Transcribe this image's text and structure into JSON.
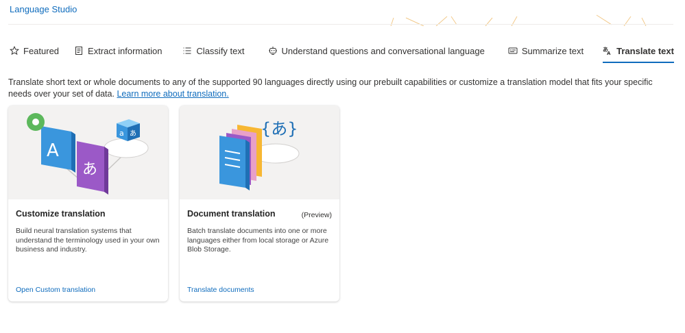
{
  "header": {
    "brand": "Language Studio"
  },
  "tabs": [
    {
      "label": "Featured",
      "icon": "star-icon",
      "active": false
    },
    {
      "label": "Extract information",
      "icon": "document-icon",
      "active": false
    },
    {
      "label": "Classify text",
      "icon": "list-icon",
      "active": false
    },
    {
      "label": "Understand questions and conversational language",
      "icon": "chat-bot-icon",
      "active": false
    },
    {
      "label": "Summarize text",
      "icon": "text-box-icon",
      "active": false
    },
    {
      "label": "Translate text",
      "icon": "translate-icon",
      "active": true
    }
  ],
  "description": {
    "text": "Translate short text or whole documents to any of the supported 90 languages directly using our prebuilt capabilities or customize a translation model that fits your specific needs over your set of data. ",
    "link": "Learn more about translation."
  },
  "cards": [
    {
      "title": "Customize translation",
      "tag": "",
      "body": "Build neural translation systems that understand the terminology used in your own business and industry.",
      "link": "Open Custom translation",
      "glyphs": [
        "A",
        "あ",
        "a",
        "あ"
      ]
    },
    {
      "title": "Document translation",
      "tag": "(Preview)",
      "body": "Batch translate documents into one or more languages either from local storage or Azure Blob Storage.",
      "link": "Translate documents",
      "glyphs": [
        "{あ}"
      ]
    }
  ],
  "colors": {
    "accent": "#0f6cbd",
    "card_art_bg": "#f3f2f1"
  }
}
